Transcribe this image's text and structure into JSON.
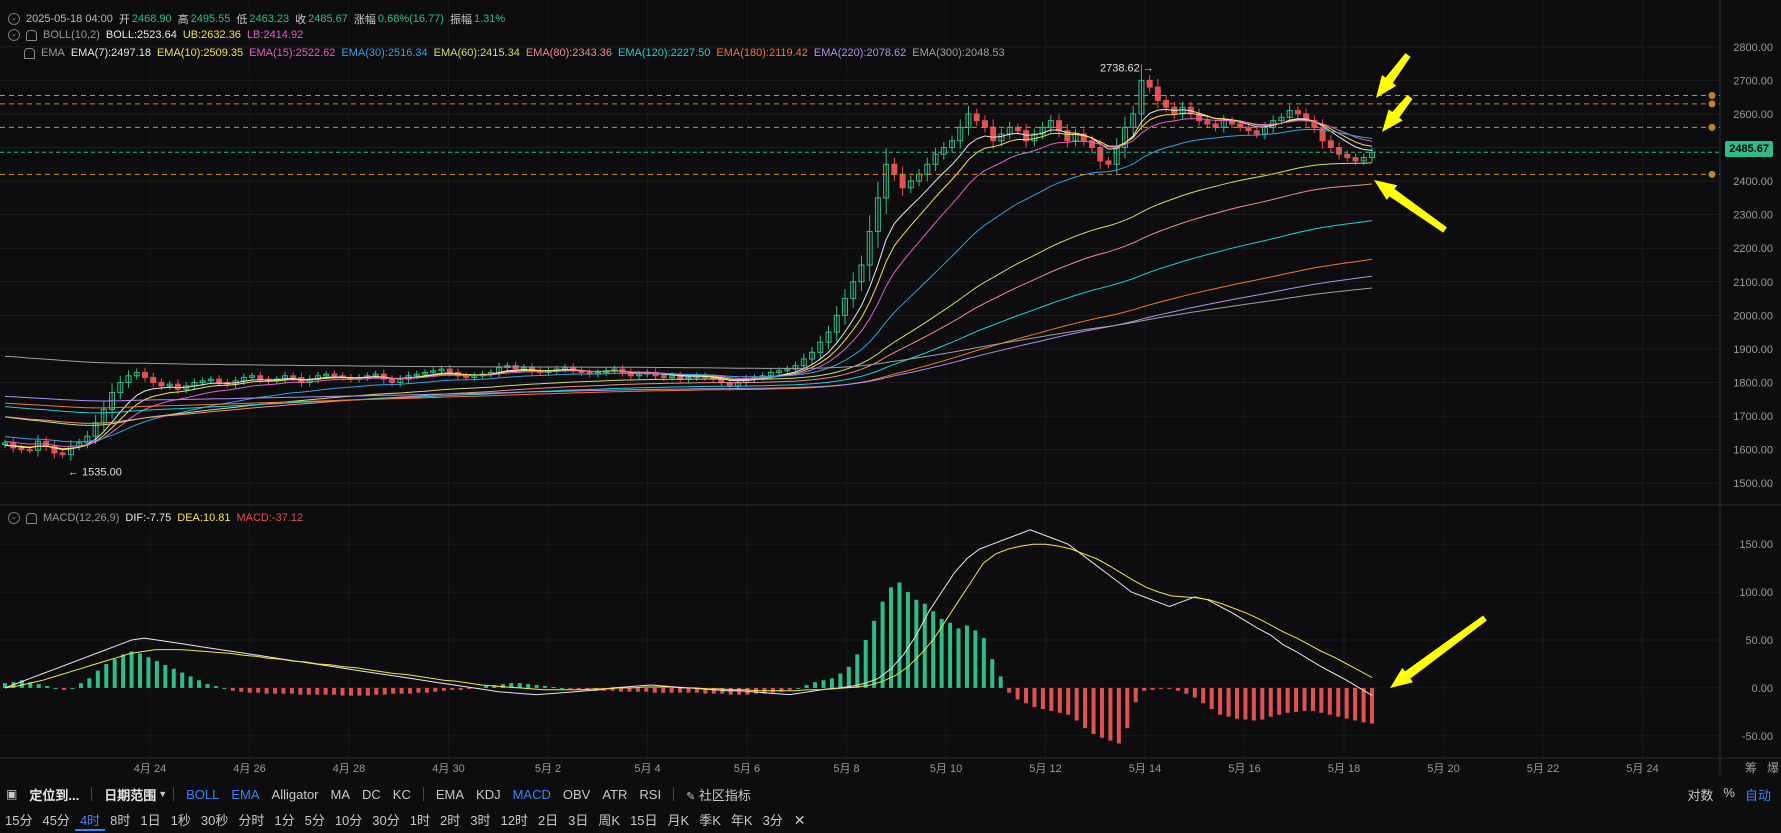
{
  "header": {
    "date": "2025-05-18 04:00",
    "open_label": "开",
    "open": "2468.90",
    "high_label": "高",
    "high": "2495.55",
    "low_label": "低",
    "low": "2463.23",
    "close_label": "收",
    "close": "2485.67",
    "change_label": "涨幅",
    "change": "0.68%(16.77)",
    "amp_label": "振幅",
    "amp": "1.31%"
  },
  "boll": {
    "name": "BOLL(10,2)",
    "mid": "BOLL:2523.64",
    "ub": "UB:2632.36",
    "lb": "LB:2414.92"
  },
  "ema": {
    "name": "EMA",
    "items": [
      {
        "label": "EMA(7):2497.18",
        "color": "#e8e8e8"
      },
      {
        "label": "EMA(10):2509.35",
        "color": "#f2e34a"
      },
      {
        "label": "EMA(15):2522.62",
        "color": "#e060c8"
      },
      {
        "label": "EMA(30):2516.34",
        "color": "#3aa0e0"
      },
      {
        "label": "EMA(60):2415.34",
        "color": "#c8e070"
      },
      {
        "label": "EMA(80):2343.36",
        "color": "#f08a8a"
      },
      {
        "label": "EMA(120):2227.50",
        "color": "#20d0d0"
      },
      {
        "label": "EMA(180):2119.42",
        "color": "#f07830"
      },
      {
        "label": "EMA(220):2078.62",
        "color": "#b090f0"
      },
      {
        "label": "EMA(300):2048.53",
        "color": "#a0a0a0"
      }
    ]
  },
  "macd": {
    "name": "MACD(12,26,9)",
    "dif": "DIF:-7.75",
    "dea": "DEA:10.81",
    "macd": "MACD:-37.12"
  },
  "price_axis": [
    "2800.00",
    "2700.00",
    "2600.00",
    "2500.00",
    "2400.00",
    "2300.00",
    "2200.00",
    "2100.00",
    "2000.00",
    "1900.00",
    "1800.00",
    "1700.00",
    "1600.00",
    "1500.00"
  ],
  "macd_axis": [
    "150.00",
    "100.00",
    "50.00",
    "0.00",
    "-50.00"
  ],
  "date_axis": [
    "4月 24",
    "4月 26",
    "4月 28",
    "4月 30",
    "5月 2",
    "5月 4",
    "5月 6",
    "5月 8",
    "5月 10",
    "5月 12",
    "5月 14",
    "5月 16",
    "5月 18",
    "5月 20",
    "5月 22",
    "5月 24"
  ],
  "current_price": "2485.67",
  "annotations": {
    "high": "2738.62 →",
    "low": "← 1535.00"
  },
  "axis_corner": [
    "筹",
    "爆"
  ],
  "toolbar1": {
    "locate": "定位到...",
    "range": "日期范围",
    "main_indicators": [
      "BOLL",
      "EMA",
      "Alligator",
      "MA",
      "DC",
      "KC"
    ],
    "sub_indicators": [
      "EMA",
      "KDJ",
      "MACD",
      "OBV",
      "ATR",
      "RSI"
    ],
    "community": "社区指标",
    "right": [
      "对数",
      "%",
      "自动"
    ]
  },
  "timeframes": [
    "15分",
    "45分",
    "4时",
    "8时",
    "1日",
    "1秒",
    "30秒",
    "分时",
    "1分",
    "5分",
    "10分",
    "30分",
    "1时",
    "2时",
    "3时",
    "12时",
    "2日",
    "3日",
    "周K",
    "15日",
    "月K",
    "季K",
    "年K",
    "3分"
  ],
  "active_timeframe": "4时",
  "chart_data": {
    "type": "candlestick",
    "price_range": [
      1450,
      2850
    ],
    "macd_range": [
      -70,
      170
    ],
    "close": [
      1620,
      1605,
      1600,
      1598,
      1625,
      1610,
      1590,
      1585,
      1610,
      1620,
      1640,
      1680,
      1720,
      1770,
      1800,
      1820,
      1830,
      1815,
      1800,
      1790,
      1795,
      1780,
      1790,
      1800,
      1805,
      1810,
      1800,
      1795,
      1805,
      1815,
      1820,
      1810,
      1805,
      1810,
      1820,
      1815,
      1800,
      1810,
      1820,
      1825,
      1820,
      1815,
      1810,
      1815,
      1820,
      1825,
      1810,
      1800,
      1810,
      1820,
      1825,
      1830,
      1835,
      1840,
      1830,
      1820,
      1815,
      1820,
      1825,
      1830,
      1845,
      1850,
      1840,
      1845,
      1835,
      1830,
      1835,
      1840,
      1845,
      1835,
      1830,
      1825,
      1830,
      1835,
      1840,
      1830,
      1820,
      1825,
      1830,
      1820,
      1815,
      1820,
      1810,
      1815,
      1820,
      1815,
      1810,
      1800,
      1790,
      1800,
      1810,
      1815,
      1820,
      1830,
      1835,
      1840,
      1850,
      1870,
      1890,
      1920,
      1950,
      2000,
      2050,
      2100,
      2150,
      2250,
      2350,
      2450,
      2420,
      2380,
      2400,
      2420,
      2450,
      2480,
      2500,
      2520,
      2560,
      2600,
      2580,
      2560,
      2520,
      2540,
      2560,
      2550,
      2520,
      2540,
      2560,
      2580,
      2550,
      2520,
      2540,
      2520,
      2500,
      2460,
      2450,
      2500,
      2560,
      2600,
      2700,
      2680,
      2640,
      2620,
      2600,
      2620,
      2600,
      2580,
      2570,
      2560,
      2580,
      2570,
      2560,
      2550,
      2540,
      2560,
      2580,
      2590,
      2610,
      2600,
      2580,
      2560,
      2520,
      2500,
      2480,
      2470,
      2460,
      2470,
      2485.67
    ],
    "macd_hist": [
      5,
      6,
      8,
      6,
      4,
      2,
      0,
      -2,
      0,
      5,
      10,
      18,
      25,
      30,
      35,
      38,
      36,
      32,
      28,
      24,
      20,
      16,
      12,
      8,
      4,
      2,
      0,
      -3,
      -4,
      -5,
      -5,
      -6,
      -6,
      -6,
      -6,
      -7,
      -7,
      -7,
      -7,
      -7,
      -8,
      -8,
      -8,
      -8,
      -7,
      -7,
      -6,
      -6,
      -6,
      -5,
      -5,
      -4,
      -3,
      -2,
      -2,
      -1,
      0,
      2,
      3,
      4,
      5,
      5,
      4,
      3,
      2,
      1,
      0,
      -1,
      -2,
      -2,
      -3,
      -3,
      -3,
      -4,
      -4,
      -4,
      -4,
      -5,
      -5,
      -5,
      -5,
      -5,
      -5,
      -6,
      -6,
      -6,
      -7,
      -7,
      -7,
      -6,
      -6,
      -5,
      -4,
      -2,
      0,
      3,
      6,
      8,
      10,
      15,
      22,
      35,
      50,
      70,
      90,
      105,
      110,
      100,
      92,
      88,
      80,
      72,
      68,
      62,
      65,
      60,
      52,
      30,
      12,
      -5,
      -12,
      -16,
      -20,
      -22,
      -24,
      -26,
      -28,
      -34,
      -42,
      -48,
      -52,
      -55,
      -58,
      -42,
      -15,
      -3,
      -2,
      -1,
      -1,
      -3,
      -6,
      -10,
      -16,
      -22,
      -28,
      -30,
      -32,
      -33,
      -34,
      -33,
      -30,
      -28,
      -26,
      -25,
      -24,
      -24,
      -26,
      -28,
      -30,
      -32,
      -34,
      -36,
      -37.12
    ],
    "dif": [
      0,
      5,
      10,
      15,
      20,
      25,
      30,
      35,
      40,
      45,
      50,
      52,
      50,
      48,
      46,
      44,
      42,
      40,
      38,
      36,
      34,
      32,
      30,
      28,
      26,
      24,
      22,
      20,
      18,
      16,
      14,
      12,
      10,
      8,
      6,
      4,
      2,
      0,
      -2,
      -4,
      -5,
      -6,
      -7,
      -6,
      -5,
      -4,
      -3,
      -2,
      0,
      1,
      2,
      3,
      2,
      1,
      0,
      -1,
      -2,
      -3,
      -3,
      -4,
      -5,
      -6,
      -7,
      -5,
      -3,
      -1,
      0,
      2,
      5,
      10,
      20,
      35,
      55,
      80,
      100,
      120,
      135,
      145,
      150,
      155,
      160,
      165,
      160,
      155,
      150,
      140,
      130,
      120,
      110,
      100,
      95,
      90,
      85,
      90,
      95,
      92,
      85,
      78,
      70,
      62,
      55,
      45,
      38,
      30,
      22,
      15,
      8,
      0,
      -7.75
    ],
    "dea": [
      0,
      2,
      5,
      8,
      12,
      16,
      20,
      24,
      28,
      32,
      36,
      38,
      40,
      40,
      40,
      39,
      38,
      37,
      36,
      34,
      33,
      31,
      30,
      28,
      27,
      25,
      24,
      22,
      21,
      19,
      17,
      15,
      14,
      12,
      10,
      8,
      7,
      5,
      3,
      2,
      1,
      0,
      -1,
      -2,
      -2,
      -2,
      -2,
      -1,
      -1,
      0,
      0,
      1,
      1,
      1,
      0,
      0,
      -1,
      -1,
      -2,
      -2,
      -3,
      -3,
      -3,
      -3,
      -2,
      -2,
      -1,
      0,
      1,
      3,
      7,
      13,
      22,
      35,
      50,
      70,
      90,
      110,
      130,
      140,
      145,
      148,
      150,
      150,
      148,
      145,
      140,
      135,
      128,
      120,
      112,
      105,
      100,
      96,
      95,
      94,
      92,
      88,
      83,
      78,
      72,
      65,
      58,
      52,
      45,
      38,
      32,
      25,
      18,
      10.81
    ]
  }
}
